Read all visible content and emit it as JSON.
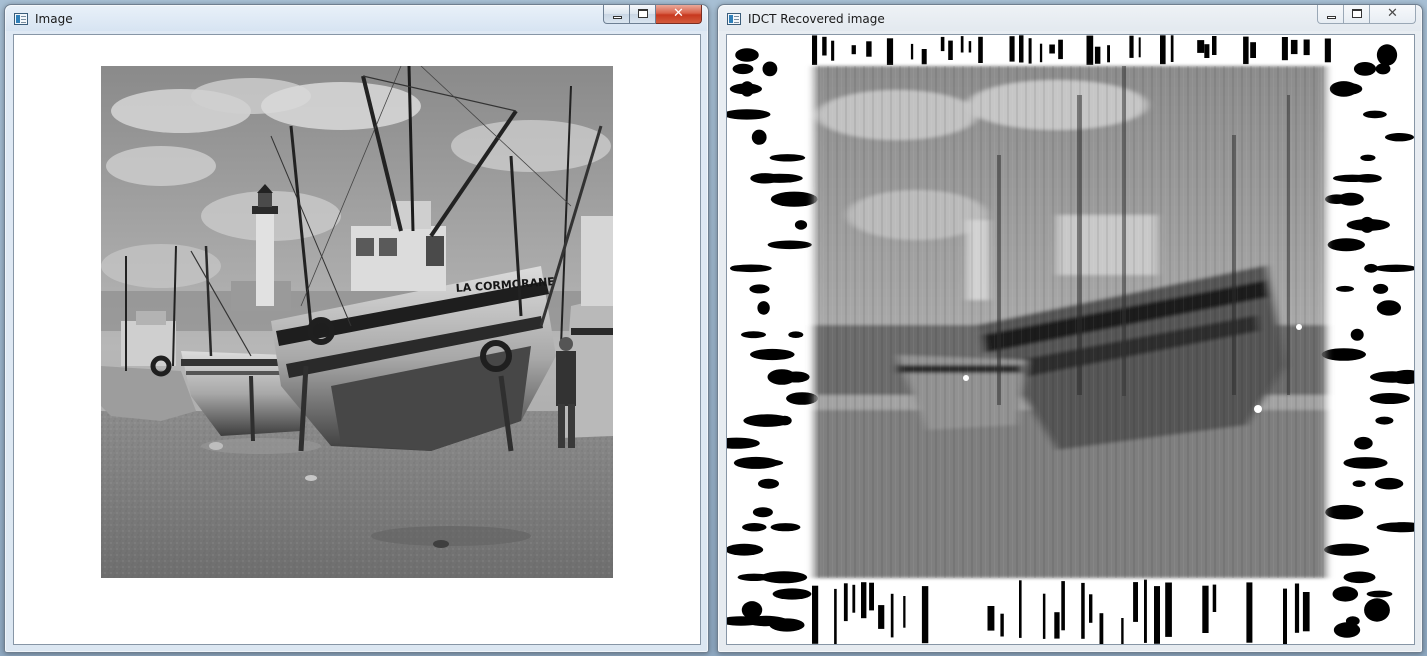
{
  "windows": [
    {
      "title": "Image",
      "state": "active",
      "content": "original grayscale photograph of fishing boats on a beach with a lighthouse",
      "boat_lettering": "LA CORMORANE"
    },
    {
      "title": "IDCT Recovered image",
      "state": "inactive",
      "content": "blurred reconstruction of the same photograph surrounded by black and white ringing artifacts"
    }
  ],
  "caption_buttons": {
    "minimize": "minimize",
    "maximize": "maximize",
    "close": "close"
  },
  "colors": {
    "desktop": "#9fb6cc",
    "frame": "#d7e4f2",
    "close_active": "#c7381f",
    "client_bg": "#ffffff"
  }
}
